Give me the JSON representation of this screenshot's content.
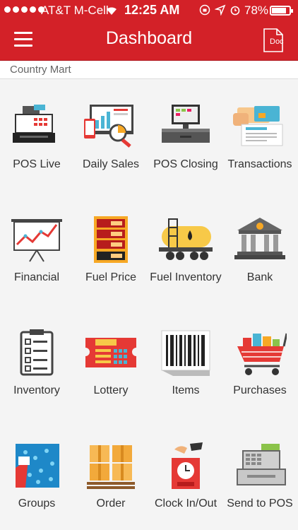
{
  "status_bar": {
    "carrier": "AT&T M-Cell",
    "time": "12:25 AM",
    "battery": "78%"
  },
  "header": {
    "title": "Dashboard",
    "doc_label": "Doc"
  },
  "store_name": "Country Mart",
  "tiles": [
    {
      "label": "POS Live",
      "icon": "cash-register-icon"
    },
    {
      "label": "Daily Sales",
      "icon": "sales-report-icon"
    },
    {
      "label": "POS Closing",
      "icon": "pos-terminal-icon"
    },
    {
      "label": "Transactions",
      "icon": "credit-card-icon"
    },
    {
      "label": "Financial",
      "icon": "line-chart-board-icon"
    },
    {
      "label": "Fuel Price",
      "icon": "fuel-price-board-icon"
    },
    {
      "label": "Fuel Inventory",
      "icon": "fuel-tanker-icon"
    },
    {
      "label": "Bank",
      "icon": "bank-icon"
    },
    {
      "label": "Inventory",
      "icon": "clipboard-checklist-icon"
    },
    {
      "label": "Lottery",
      "icon": "lotto-ticket-icon"
    },
    {
      "label": "Items",
      "icon": "barcode-icon"
    },
    {
      "label": "Purchases",
      "icon": "shopping-cart-icon"
    },
    {
      "label": "Groups",
      "icon": "groups-icon"
    },
    {
      "label": "Order",
      "icon": "boxes-icon"
    },
    {
      "label": "Clock In/Out",
      "icon": "time-clock-icon"
    },
    {
      "label": "Send to POS",
      "icon": "register-send-icon"
    }
  ],
  "colors": {
    "brand": "#d32128",
    "background": "#f4f4f4"
  }
}
